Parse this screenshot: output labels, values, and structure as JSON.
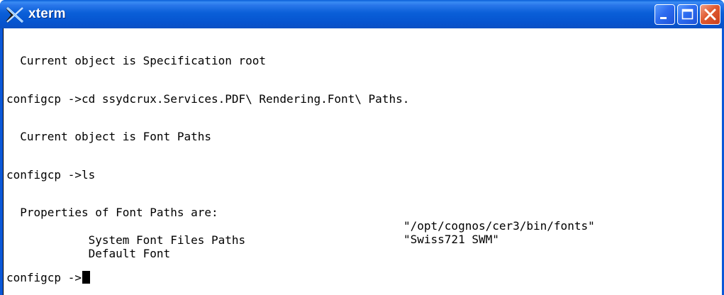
{
  "window": {
    "title": "xterm",
    "controls": {
      "minimize": "minimize",
      "maximize": "maximize",
      "close": "close"
    }
  },
  "terminal": {
    "lines": {
      "current_root": "  Current object is Specification root",
      "cd_command": "configcp ->cd ssydcrux.Services.PDF\\ Rendering.Font\\ Paths.",
      "current_font_paths": "  Current object is Font Paths",
      "ls_command": "configcp ->ls",
      "properties_header": "  Properties of Font Paths are:"
    },
    "properties": [
      {
        "name": "    System Font Files Paths",
        "value": "\"/opt/cognos/cer3/bin/fonts\""
      },
      {
        "name": "    Default Font",
        "value": "\"Swiss721 SWM\""
      }
    ],
    "prompt": "configcp ->"
  }
}
